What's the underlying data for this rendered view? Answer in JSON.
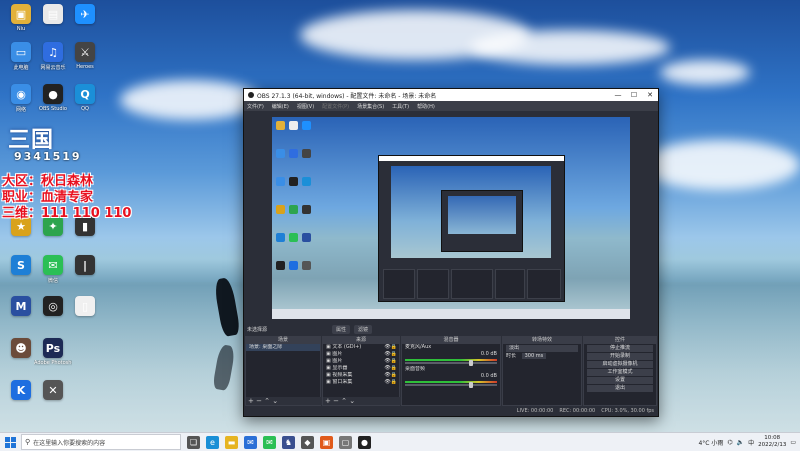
{
  "desktop_icons": [
    {
      "label": "Niu",
      "glyph": "▣",
      "color": "#e2b13a"
    },
    {
      "label": "",
      "glyph": "▤",
      "color": "#e9e9e9"
    },
    {
      "label": "",
      "glyph": "✈",
      "color": "#1e90ff"
    },
    {
      "label": "此电脑",
      "glyph": "▭",
      "color": "#3a8ee6"
    },
    {
      "label": "网易云音乐",
      "glyph": "♫",
      "color": "#2f6de0"
    },
    {
      "label": "Heroes",
      "glyph": "⚔",
      "color": "#444"
    },
    {
      "label": "网络",
      "glyph": "◉",
      "color": "#3a8ee6"
    },
    {
      "label": "OBS Studio",
      "glyph": "●",
      "color": "#222"
    },
    {
      "label": "QQ",
      "glyph": "Q",
      "color": "#1b8fd8"
    },
    {
      "label": "",
      "glyph": "★",
      "color": "#d9a21b"
    },
    {
      "label": "",
      "glyph": "✦",
      "color": "#2da44e"
    },
    {
      "label": "",
      "glyph": "▮",
      "color": "#333"
    },
    {
      "label": "",
      "glyph": "S",
      "color": "#1e7fd6"
    },
    {
      "label": "微信",
      "glyph": "✉",
      "color": "#2bbf55"
    },
    {
      "label": "",
      "glyph": "|",
      "color": "#333"
    },
    {
      "label": "",
      "glyph": "M",
      "color": "#2a4fa0"
    },
    {
      "label": "",
      "glyph": "◎",
      "color": "#222"
    },
    {
      "label": "",
      "glyph": "▯",
      "color": "#f0f0f0"
    },
    {
      "label": "",
      "glyph": "☻",
      "color": "#6b4b3a"
    },
    {
      "label": "Adobe Photoshop",
      "glyph": "Ps",
      "color": "#1d2a55"
    },
    {
      "label": "",
      "glyph": "K",
      "color": "#1e6ee0"
    },
    {
      "label": "",
      "glyph": "✕",
      "color": "#555"
    }
  ],
  "overlay": {
    "logo": "三国",
    "number": "9341519",
    "lines": [
      "大区：秋日森林",
      "职业：血清专家",
      "三维：111 110 110"
    ]
  },
  "obs": {
    "title": "OBS 27.1.3 (64-bit, windows) - 配置文件: 未命名 - 场景: 未命名",
    "controls": [
      "—",
      "☐",
      "✕"
    ],
    "menu": [
      {
        "label": "文件(F)",
        "dim": false
      },
      {
        "label": "编辑(E)",
        "dim": false
      },
      {
        "label": "视图(V)",
        "dim": false
      },
      {
        "label": "配置文件(P)",
        "dim": true
      },
      {
        "label": "场景集合(S)",
        "dim": false
      },
      {
        "label": "工具(T)",
        "dim": false
      },
      {
        "label": "帮助(H)",
        "dim": false
      }
    ],
    "scene_label": "未选择源",
    "scene_buttons": [
      "属性",
      "滤镜"
    ],
    "docks": {
      "scenes": {
        "title": "场景",
        "items": [
          "场景: 桌面之际"
        ]
      },
      "sources": {
        "title": "来源",
        "items": [
          "文本 (GDI+)",
          "图片",
          "图片",
          "显示器",
          "视频采集",
          "窗口采集"
        ]
      },
      "mixer": {
        "title": "混音器",
        "channels": [
          {
            "name": "桌面音频",
            "db": "0.0 dB"
          },
          {
            "name": "麦克风/Aux",
            "db": "0.0 dB"
          }
        ]
      },
      "transitions": {
        "title": "转场特效",
        "type": "淡出",
        "duration_label": "时长",
        "duration": "300 ms"
      },
      "controls": {
        "title": "控件",
        "buttons": [
          "停止推流",
          "开始录制",
          "启动虚拟摄像机",
          "工作室模式",
          "设置",
          "退出"
        ]
      }
    },
    "status": {
      "live": "LIVE: 00:00:00",
      "rec": "REC: 00:00:00",
      "cpu": "CPU: 3.0%, 30.00 fps"
    },
    "dock_footer_glyphs": "+ − ⌃ ⌄"
  },
  "taskbar": {
    "search_placeholder": "在这里输入你要搜索的内容",
    "apps": [
      {
        "name": "task-view",
        "glyph": "❏",
        "color": "#555"
      },
      {
        "name": "edge",
        "glyph": "e",
        "color": "#1a8fd6"
      },
      {
        "name": "explorer",
        "glyph": "▬",
        "color": "#e6b422"
      },
      {
        "name": "mail",
        "glyph": "✉",
        "color": "#2b6fd6"
      },
      {
        "name": "wechat",
        "glyph": "✉",
        "color": "#2bbf55"
      },
      {
        "name": "app5",
        "glyph": "♞",
        "color": "#3a4f8f"
      },
      {
        "name": "app6",
        "glyph": "◆",
        "color": "#555"
      },
      {
        "name": "app7",
        "glyph": "▣",
        "color": "#e05a1b"
      },
      {
        "name": "app8",
        "glyph": "▢",
        "color": "#777"
      },
      {
        "name": "obs",
        "glyph": "●",
        "color": "#222"
      }
    ],
    "weather": "4°C 小雨",
    "lang": "中",
    "time": "10:08",
    "date": "2022/2/13"
  }
}
